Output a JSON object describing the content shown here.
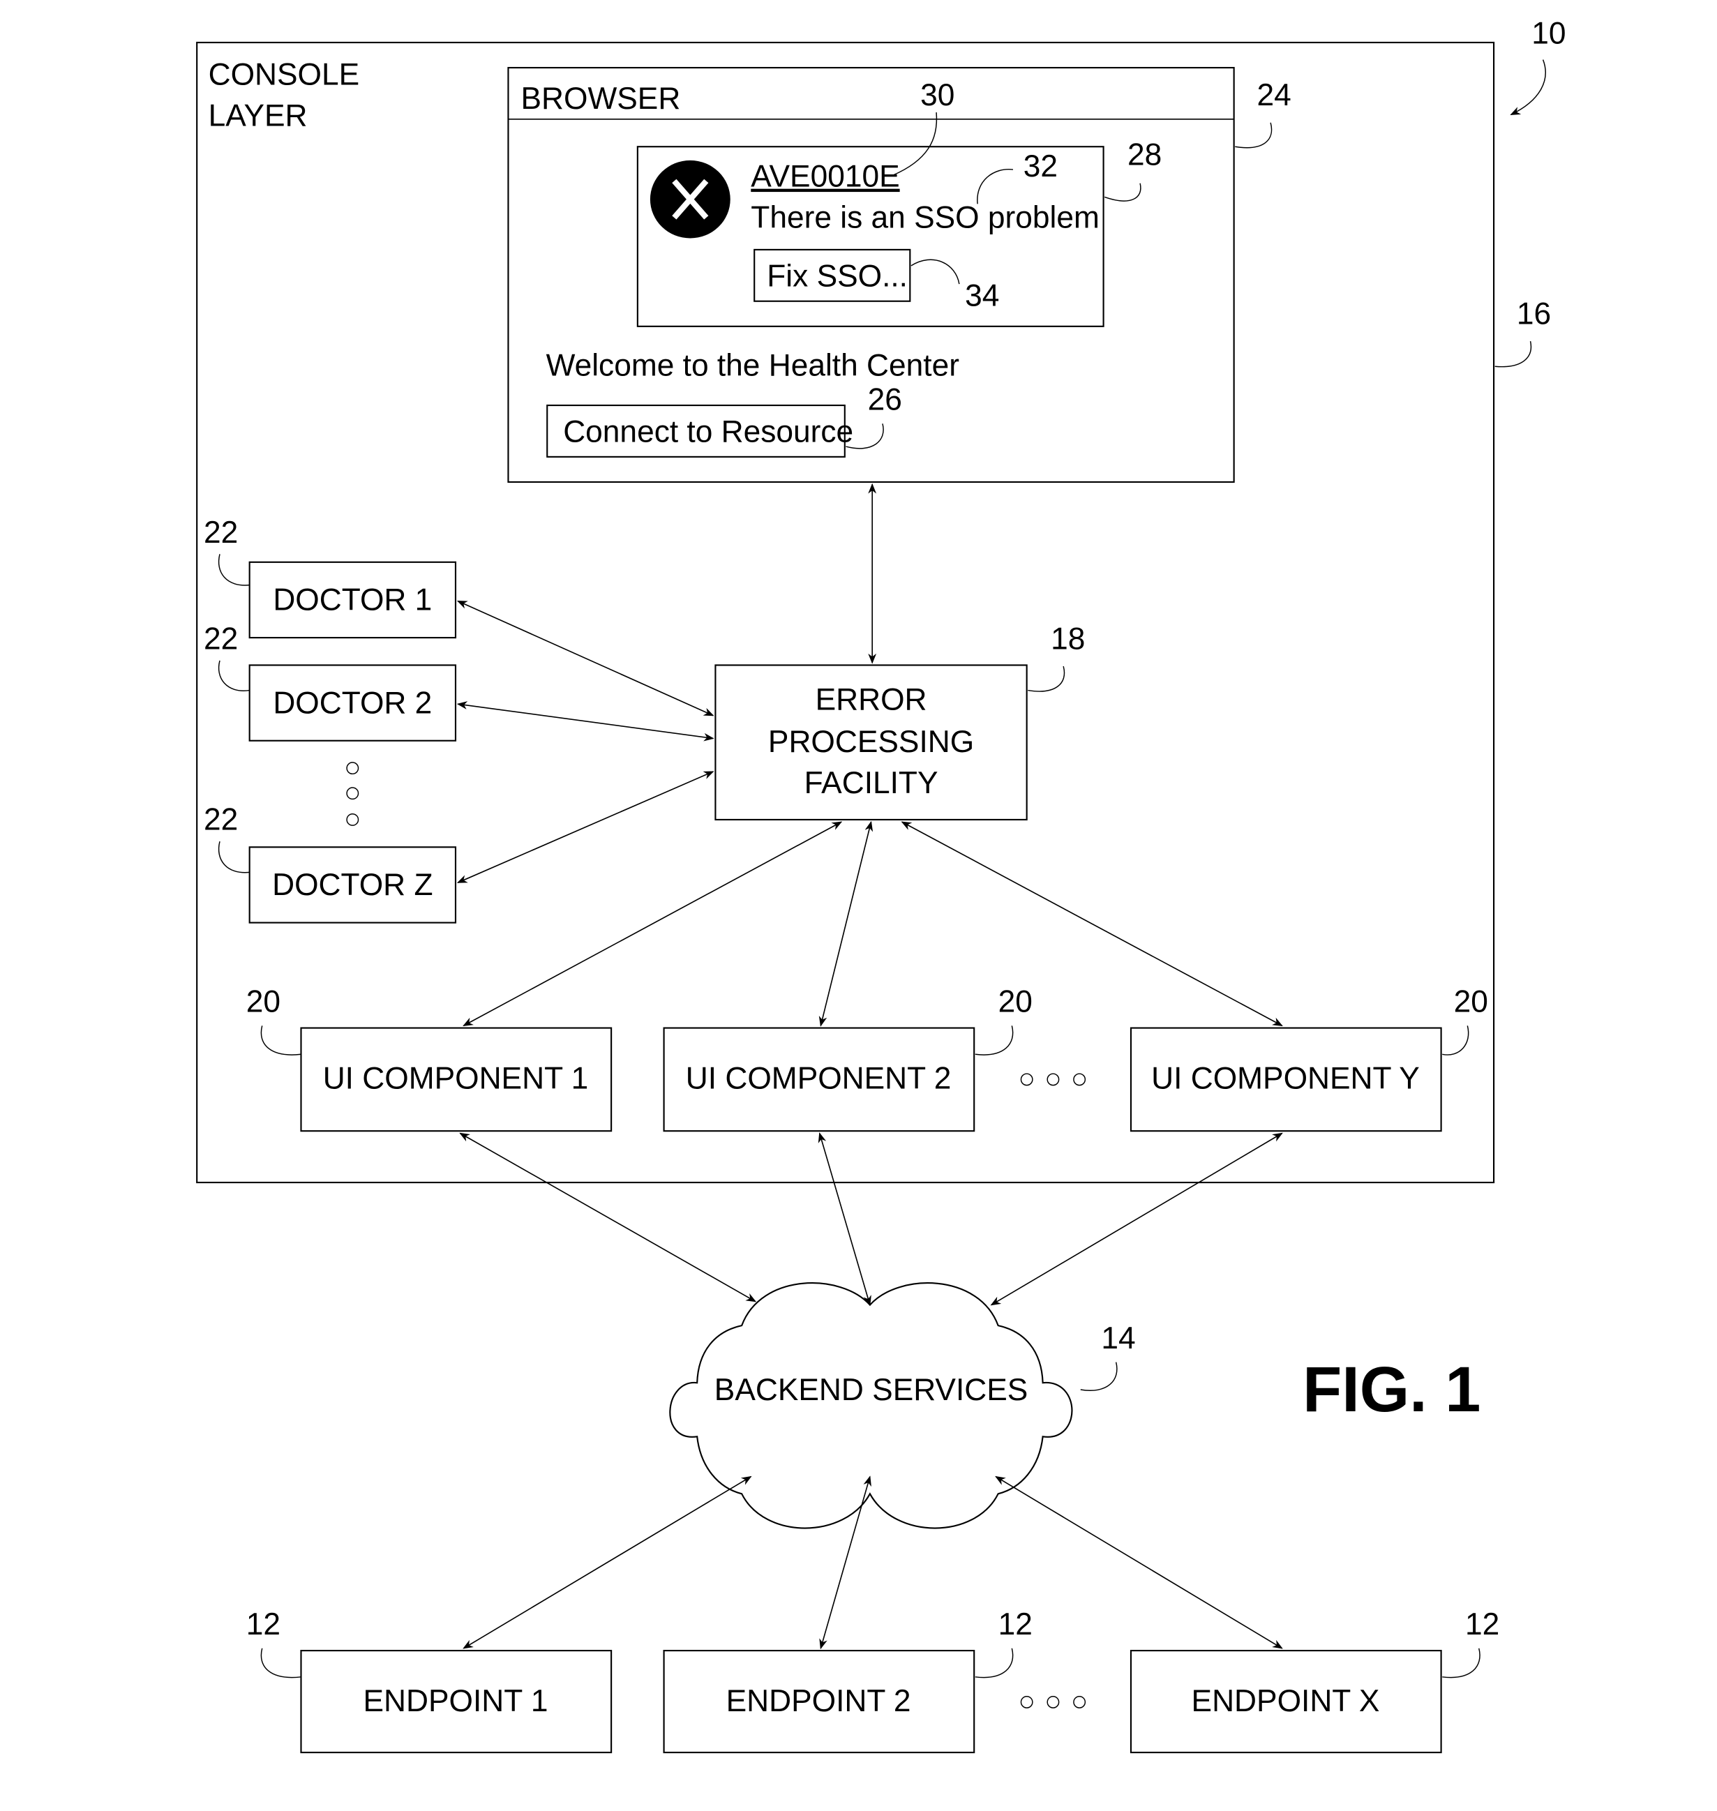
{
  "figure": {
    "title": "FIG. 1",
    "system_ref": "10"
  },
  "console_layer": {
    "label_line1": "CONSOLE",
    "label_line2": "LAYER",
    "ref": "16"
  },
  "browser": {
    "title": "BROWSER",
    "ref": "24",
    "error_panel": {
      "ref": "28",
      "error_code": "AVE0010E",
      "error_code_ref": "30",
      "message": "There is an SSO problem",
      "message_ref": "32",
      "fix_button_label": "Fix SSO...",
      "fix_button_ref": "34"
    },
    "welcome_text": "Welcome to the Health Center",
    "connect_button_label": "Connect to Resource",
    "connect_button_ref": "26"
  },
  "error_processing": {
    "line1": "ERROR",
    "line2": "PROCESSING",
    "line3": "FACILITY",
    "ref": "18"
  },
  "doctors": [
    {
      "label": "DOCTOR 1",
      "ref": "22"
    },
    {
      "label": "DOCTOR 2",
      "ref": "22"
    },
    {
      "label": "DOCTOR Z",
      "ref": "22"
    }
  ],
  "ui_components": [
    {
      "label": "UI COMPONENT 1",
      "ref": "20"
    },
    {
      "label": "UI COMPONENT 2",
      "ref": "20"
    },
    {
      "label": "UI COMPONENT Y",
      "ref": "20"
    }
  ],
  "backend": {
    "label": "BACKEND SERVICES",
    "ref": "14"
  },
  "endpoints": [
    {
      "label": "ENDPOINT 1",
      "ref": "12"
    },
    {
      "label": "ENDPOINT 2",
      "ref": "12"
    },
    {
      "label": "ENDPOINT X",
      "ref": "12"
    }
  ]
}
